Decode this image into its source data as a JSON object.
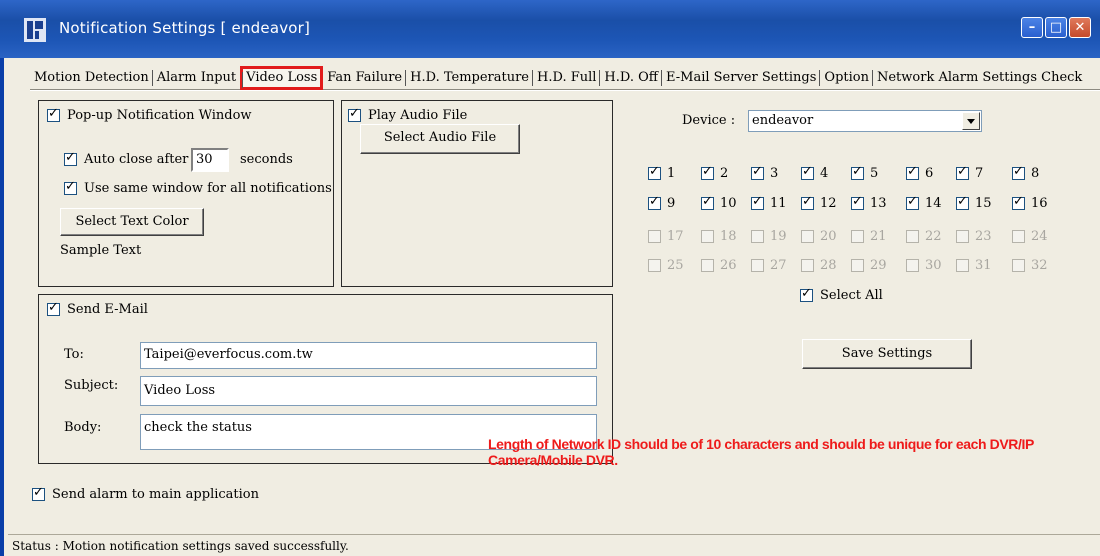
{
  "window": {
    "title": "Notification Settings  [ endeavor]",
    "minimize_glyph": "–",
    "maximize_glyph": "□",
    "close_glyph": "✕"
  },
  "tabs": [
    {
      "label": "Motion Detection",
      "active": false
    },
    {
      "label": "Alarm Input",
      "active": false
    },
    {
      "label": "Video Loss",
      "active": true
    },
    {
      "label": "Fan Failure",
      "active": false
    },
    {
      "label": "H.D. Temperature",
      "active": false
    },
    {
      "label": "H.D. Full",
      "active": false
    },
    {
      "label": "H.D. Off",
      "active": false
    },
    {
      "label": "E-Mail Server Settings",
      "active": false
    },
    {
      "label": "Option",
      "active": false
    },
    {
      "label": "Network Alarm Settings Check",
      "active": false
    }
  ],
  "popup": {
    "label": "Pop-up Notification Window",
    "checked": true,
    "auto_close_label": "Auto close after",
    "auto_close_value": "30",
    "seconds_label": "seconds",
    "same_window_label": "Use same window for all notifications",
    "select_text_color": "Select Text Color",
    "sample_text": "Sample Text"
  },
  "audio": {
    "label": "Play Audio File",
    "checked": true,
    "select_button": "Select Audio File"
  },
  "device": {
    "label": "Device :",
    "value": "endeavor"
  },
  "channels": [
    {
      "n": "1",
      "checked": true,
      "enabled": true
    },
    {
      "n": "2",
      "checked": true,
      "enabled": true
    },
    {
      "n": "3",
      "checked": true,
      "enabled": true
    },
    {
      "n": "4",
      "checked": true,
      "enabled": true
    },
    {
      "n": "5",
      "checked": true,
      "enabled": true
    },
    {
      "n": "6",
      "checked": true,
      "enabled": true
    },
    {
      "n": "7",
      "checked": true,
      "enabled": true
    },
    {
      "n": "8",
      "checked": true,
      "enabled": true
    },
    {
      "n": "9",
      "checked": true,
      "enabled": true
    },
    {
      "n": "10",
      "checked": true,
      "enabled": true
    },
    {
      "n": "11",
      "checked": true,
      "enabled": true
    },
    {
      "n": "12",
      "checked": true,
      "enabled": true
    },
    {
      "n": "13",
      "checked": true,
      "enabled": true
    },
    {
      "n": "14",
      "checked": true,
      "enabled": true
    },
    {
      "n": "15",
      "checked": true,
      "enabled": true
    },
    {
      "n": "16",
      "checked": true,
      "enabled": true
    },
    {
      "n": "17",
      "checked": false,
      "enabled": false
    },
    {
      "n": "18",
      "checked": false,
      "enabled": false
    },
    {
      "n": "19",
      "checked": false,
      "enabled": false
    },
    {
      "n": "20",
      "checked": false,
      "enabled": false
    },
    {
      "n": "21",
      "checked": false,
      "enabled": false
    },
    {
      "n": "22",
      "checked": false,
      "enabled": false
    },
    {
      "n": "23",
      "checked": false,
      "enabled": false
    },
    {
      "n": "24",
      "checked": false,
      "enabled": false
    },
    {
      "n": "25",
      "checked": false,
      "enabled": false
    },
    {
      "n": "26",
      "checked": false,
      "enabled": false
    },
    {
      "n": "27",
      "checked": false,
      "enabled": false
    },
    {
      "n": "28",
      "checked": false,
      "enabled": false
    },
    {
      "n": "29",
      "checked": false,
      "enabled": false
    },
    {
      "n": "30",
      "checked": false,
      "enabled": false
    },
    {
      "n": "31",
      "checked": false,
      "enabled": false
    },
    {
      "n": "32",
      "checked": false,
      "enabled": false
    }
  ],
  "select_all": {
    "label": "Select All",
    "checked": true
  },
  "save_button": "Save Settings",
  "email": {
    "label": "Send E-Mail",
    "checked": true,
    "to_label": "To:",
    "to_value": "Taipei@everfocus.com.tw",
    "subject_label": "Subject:",
    "subject_value": "Video Loss",
    "body_label": "Body:",
    "body_value": "check the status"
  },
  "send_alarm": {
    "label": "Send alarm to main application",
    "checked": true
  },
  "warning": "Length of Network ID should be of 10 characters and should be unique for each DVR/IP Camera/Mobile DVR.",
  "status": "Status : Motion notification settings saved successfully.",
  "colors": {
    "warning": "#ee1b1b",
    "active_tab_border": "#e11b1b",
    "title_bar": "#1d56b6"
  }
}
